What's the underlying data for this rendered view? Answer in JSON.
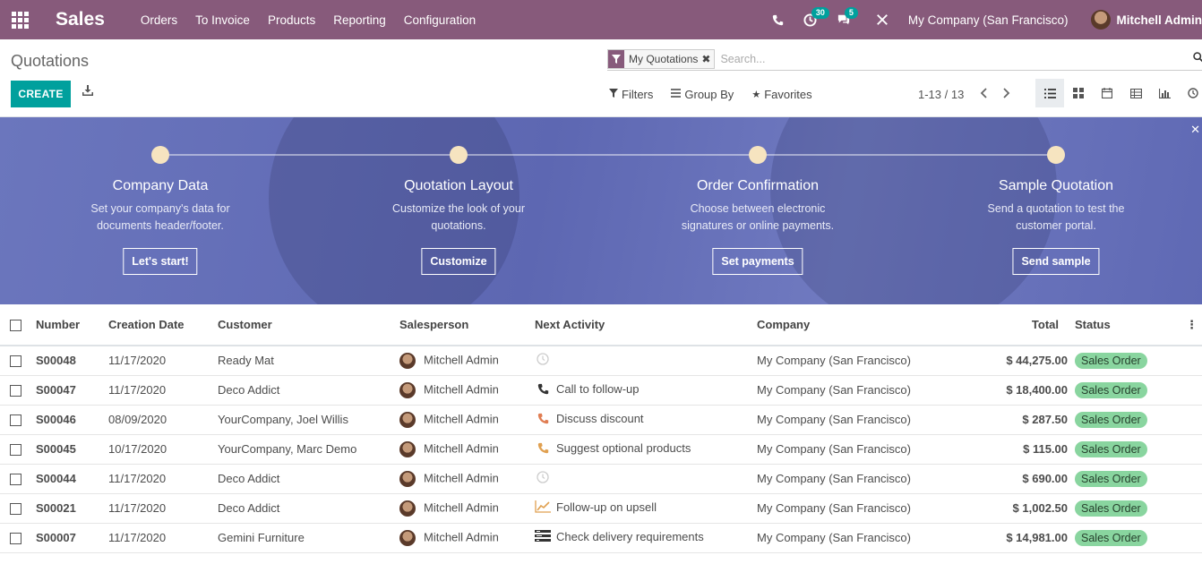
{
  "navbar": {
    "app_name": "Sales",
    "menu": [
      "Orders",
      "To Invoice",
      "Products",
      "Reporting",
      "Configuration"
    ],
    "activity_badge": "30",
    "messages_badge": "5",
    "company": "My Company (San Francisco)",
    "user": "Mitchell Admin"
  },
  "control_panel": {
    "breadcrumb": "Quotations",
    "facet_label": "My Quotations",
    "search_placeholder": "Search...",
    "create_label": "CREATE",
    "filters_label": "Filters",
    "groupby_label": "Group By",
    "favorites_label": "Favorites",
    "pager": "1-13 / 13"
  },
  "banner": {
    "steps": [
      {
        "title": "Company Data",
        "desc": "Set your company's data for documents header/footer.",
        "button": "Let's start!"
      },
      {
        "title": "Quotation Layout",
        "desc": "Customize the look of your quotations.",
        "button": "Customize"
      },
      {
        "title": "Order Confirmation",
        "desc": "Choose between electronic signatures or online payments.",
        "button": "Set payments"
      },
      {
        "title": "Sample Quotation",
        "desc": "Send a quotation to test the customer portal.",
        "button": "Send sample"
      }
    ]
  },
  "table": {
    "headers": {
      "number": "Number",
      "creation_date": "Creation Date",
      "customer": "Customer",
      "salesperson": "Salesperson",
      "next_activity": "Next Activity",
      "company": "Company",
      "total": "Total",
      "status": "Status"
    },
    "rows": [
      {
        "number": "S00048",
        "date": "11/17/2020",
        "customer": "Ready Mat",
        "salesperson": "Mitchell Admin",
        "activity": "",
        "activity_icon": "clock-icon",
        "company": "My Company (San Francisco)",
        "total": "$ 44,275.00",
        "status": "Sales Order"
      },
      {
        "number": "S00047",
        "date": "11/17/2020",
        "customer": "Deco Addict",
        "salesperson": "Mitchell Admin",
        "activity": "Call to follow-up",
        "activity_icon": "phone-icon",
        "company": "My Company (San Francisco)",
        "total": "$ 18,400.00",
        "status": "Sales Order"
      },
      {
        "number": "S00046",
        "date": "08/09/2020",
        "customer": "YourCompany, Joel Willis",
        "salesperson": "Mitchell Admin",
        "activity": "Discuss discount",
        "activity_icon": "phone-icon",
        "company": "My Company (San Francisco)",
        "total": "$ 287.50",
        "status": "Sales Order"
      },
      {
        "number": "S00045",
        "date": "10/17/2020",
        "customer": "YourCompany, Marc Demo",
        "salesperson": "Mitchell Admin",
        "activity": "Suggest optional products",
        "activity_icon": "phone-icon",
        "company": "My Company (San Francisco)",
        "total": "$ 115.00",
        "status": "Sales Order"
      },
      {
        "number": "S00044",
        "date": "11/17/2020",
        "customer": "Deco Addict",
        "salesperson": "Mitchell Admin",
        "activity": "",
        "activity_icon": "clock-icon",
        "company": "My Company (San Francisco)",
        "total": "$ 690.00",
        "status": "Sales Order"
      },
      {
        "number": "S00021",
        "date": "11/17/2020",
        "customer": "Deco Addict",
        "salesperson": "Mitchell Admin",
        "activity": "Follow-up on upsell",
        "activity_icon": "upsell-chart-icon",
        "company": "My Company (San Francisco)",
        "total": "$ 1,002.50",
        "status": "Sales Order"
      },
      {
        "number": "S00007",
        "date": "11/17/2020",
        "customer": "Gemini Furniture",
        "salesperson": "Mitchell Admin",
        "activity": "Check delivery requirements",
        "activity_icon": "tasks-icon",
        "company": "My Company (San Francisco)",
        "total": "$ 14,981.00",
        "status": "Sales Order"
      }
    ]
  },
  "colors": {
    "brand": "#875a7b",
    "accent": "#00a09d",
    "status_green": "#89d59f"
  }
}
